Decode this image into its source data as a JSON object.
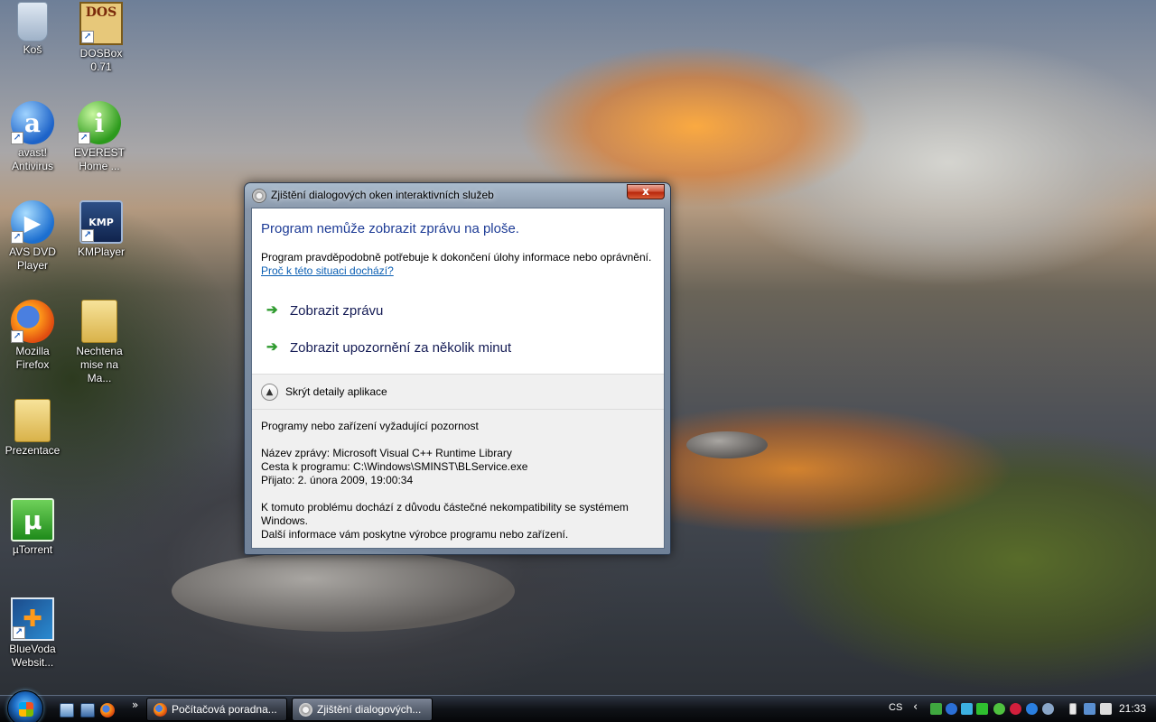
{
  "desktop": {
    "icons": [
      {
        "label": "Koš"
      },
      {
        "label": "DOSBox 0.71",
        "glyph": "DOS"
      },
      {
        "label": "avast!\nAntivirus",
        "glyph": "a"
      },
      {
        "label": "EVEREST\nHome ...",
        "glyph": "i"
      },
      {
        "label": "AVS DVD\nPlayer",
        "glyph": "▶"
      },
      {
        "label": "KMPlayer",
        "glyph": "KMP"
      },
      {
        "label": "Mozilla\nFirefox"
      },
      {
        "label": "Nechtena\nmise na Ma..."
      },
      {
        "label": "Prezentace"
      },
      {
        "label": "µTorrent",
        "glyph": "µ"
      },
      {
        "label": "BlueVoda\nWebsit...",
        "glyph": "✚"
      }
    ]
  },
  "dialog": {
    "title": "Zjištění dialogových oken interaktivních služeb",
    "close_glyph": "x",
    "main_instruction": "Program nemůže zobrazit zprávu na ploše.",
    "content": "Program pravděpodobně potřebuje k dokončení úlohy informace nebo oprávnění.",
    "help_link": "Proč k této situaci dochází?",
    "command_links": [
      {
        "label": "Zobrazit zprávu"
      },
      {
        "label": "Zobrazit upozornění za několik minut"
      }
    ],
    "details_toggle_label": "Skrýt detaily aplikace",
    "details": {
      "heading": "Programy nebo zařízení vyžadující pozornost",
      "message_name": "Název zprávy:  Microsoft Visual C++ Runtime Library",
      "program_path": "Cesta k programu:  C:\\Windows\\SMINST\\BLService.exe",
      "received": "Přijato:  2. února 2009, 19:00:34",
      "note_line1": "K tomuto problému dochází z důvodu částečné nekompatibility se systémem",
      "note_line2": "Windows.",
      "note_line3": "Další informace vám poskytne výrobce programu nebo zařízení."
    }
  },
  "taskbar": {
    "quick_launch_more": "»",
    "buttons": [
      {
        "label": "Počítačová poradna..."
      },
      {
        "label": "Zjištění dialogových..."
      }
    ],
    "language": "CS",
    "tray_expand": "‹",
    "clock": "21:33"
  }
}
